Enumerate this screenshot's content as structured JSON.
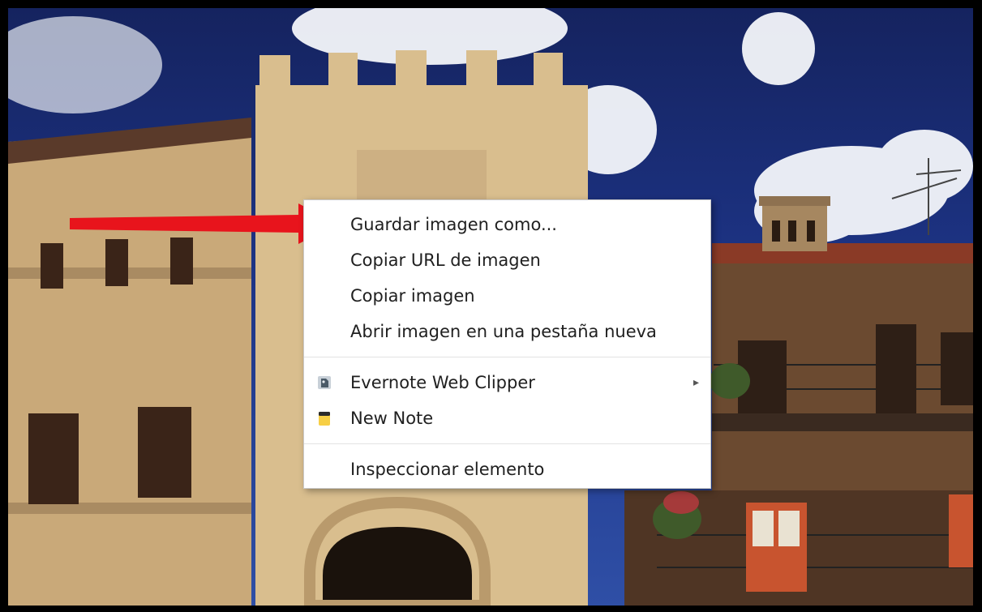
{
  "context_menu": {
    "groups": [
      {
        "items": [
          {
            "label": "Guardar imagen como..."
          },
          {
            "label": "Copiar URL de imagen"
          },
          {
            "label": "Copiar imagen"
          },
          {
            "label": "Abrir imagen en una pestaña nueva"
          }
        ]
      },
      {
        "items": [
          {
            "label": "Evernote Web Clipper",
            "icon": "evernote-elephant-icon",
            "has_submenu": true
          },
          {
            "label": "New Note",
            "icon": "notepad-icon"
          }
        ]
      },
      {
        "items": [
          {
            "label": "Inspeccionar elemento"
          }
        ]
      }
    ]
  },
  "annotation": {
    "arrow_color": "#e8141c",
    "arrow_target": "Guardar imagen como..."
  },
  "colors": {
    "sky": "#1d3486",
    "stone": "#d2b48a",
    "menu_background": "#ffffff"
  }
}
